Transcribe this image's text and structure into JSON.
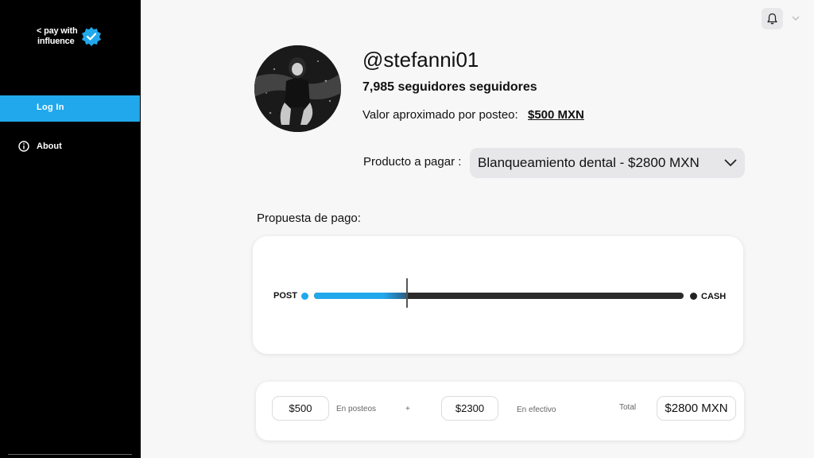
{
  "sidebar": {
    "logo": {
      "line1": "< pay with",
      "line2": "influence"
    },
    "items": [
      {
        "label": "Log In",
        "active": true
      },
      {
        "label": "About",
        "icon": "info-icon"
      }
    ]
  },
  "header": {
    "bell_icon": "bell-icon",
    "menu_icon": "chevron-down-icon"
  },
  "profile": {
    "username": "@stefanni01",
    "followers": "7,985 seguidores seguidores",
    "valor_label": "Valor aproximado por posteo:",
    "valor_value": "$500 MXN"
  },
  "producto": {
    "label": "Producto a pagar :",
    "selected": "Blanqueamiento dental - $2800 MXN"
  },
  "propuesta": {
    "label": "Propuesta de pago:",
    "left_label": "POST",
    "right_label": "CASH",
    "post_fraction": 0.25
  },
  "totals": {
    "posts_value": "$500",
    "posts_label": "En posteos",
    "plus": "+",
    "cash_value": "$2300",
    "cash_label": "En efectivo",
    "total_label": "Total",
    "total_value": "$2800 MXN"
  },
  "colors": {
    "accent": "#21a8ec",
    "sidebar": "#000000"
  }
}
